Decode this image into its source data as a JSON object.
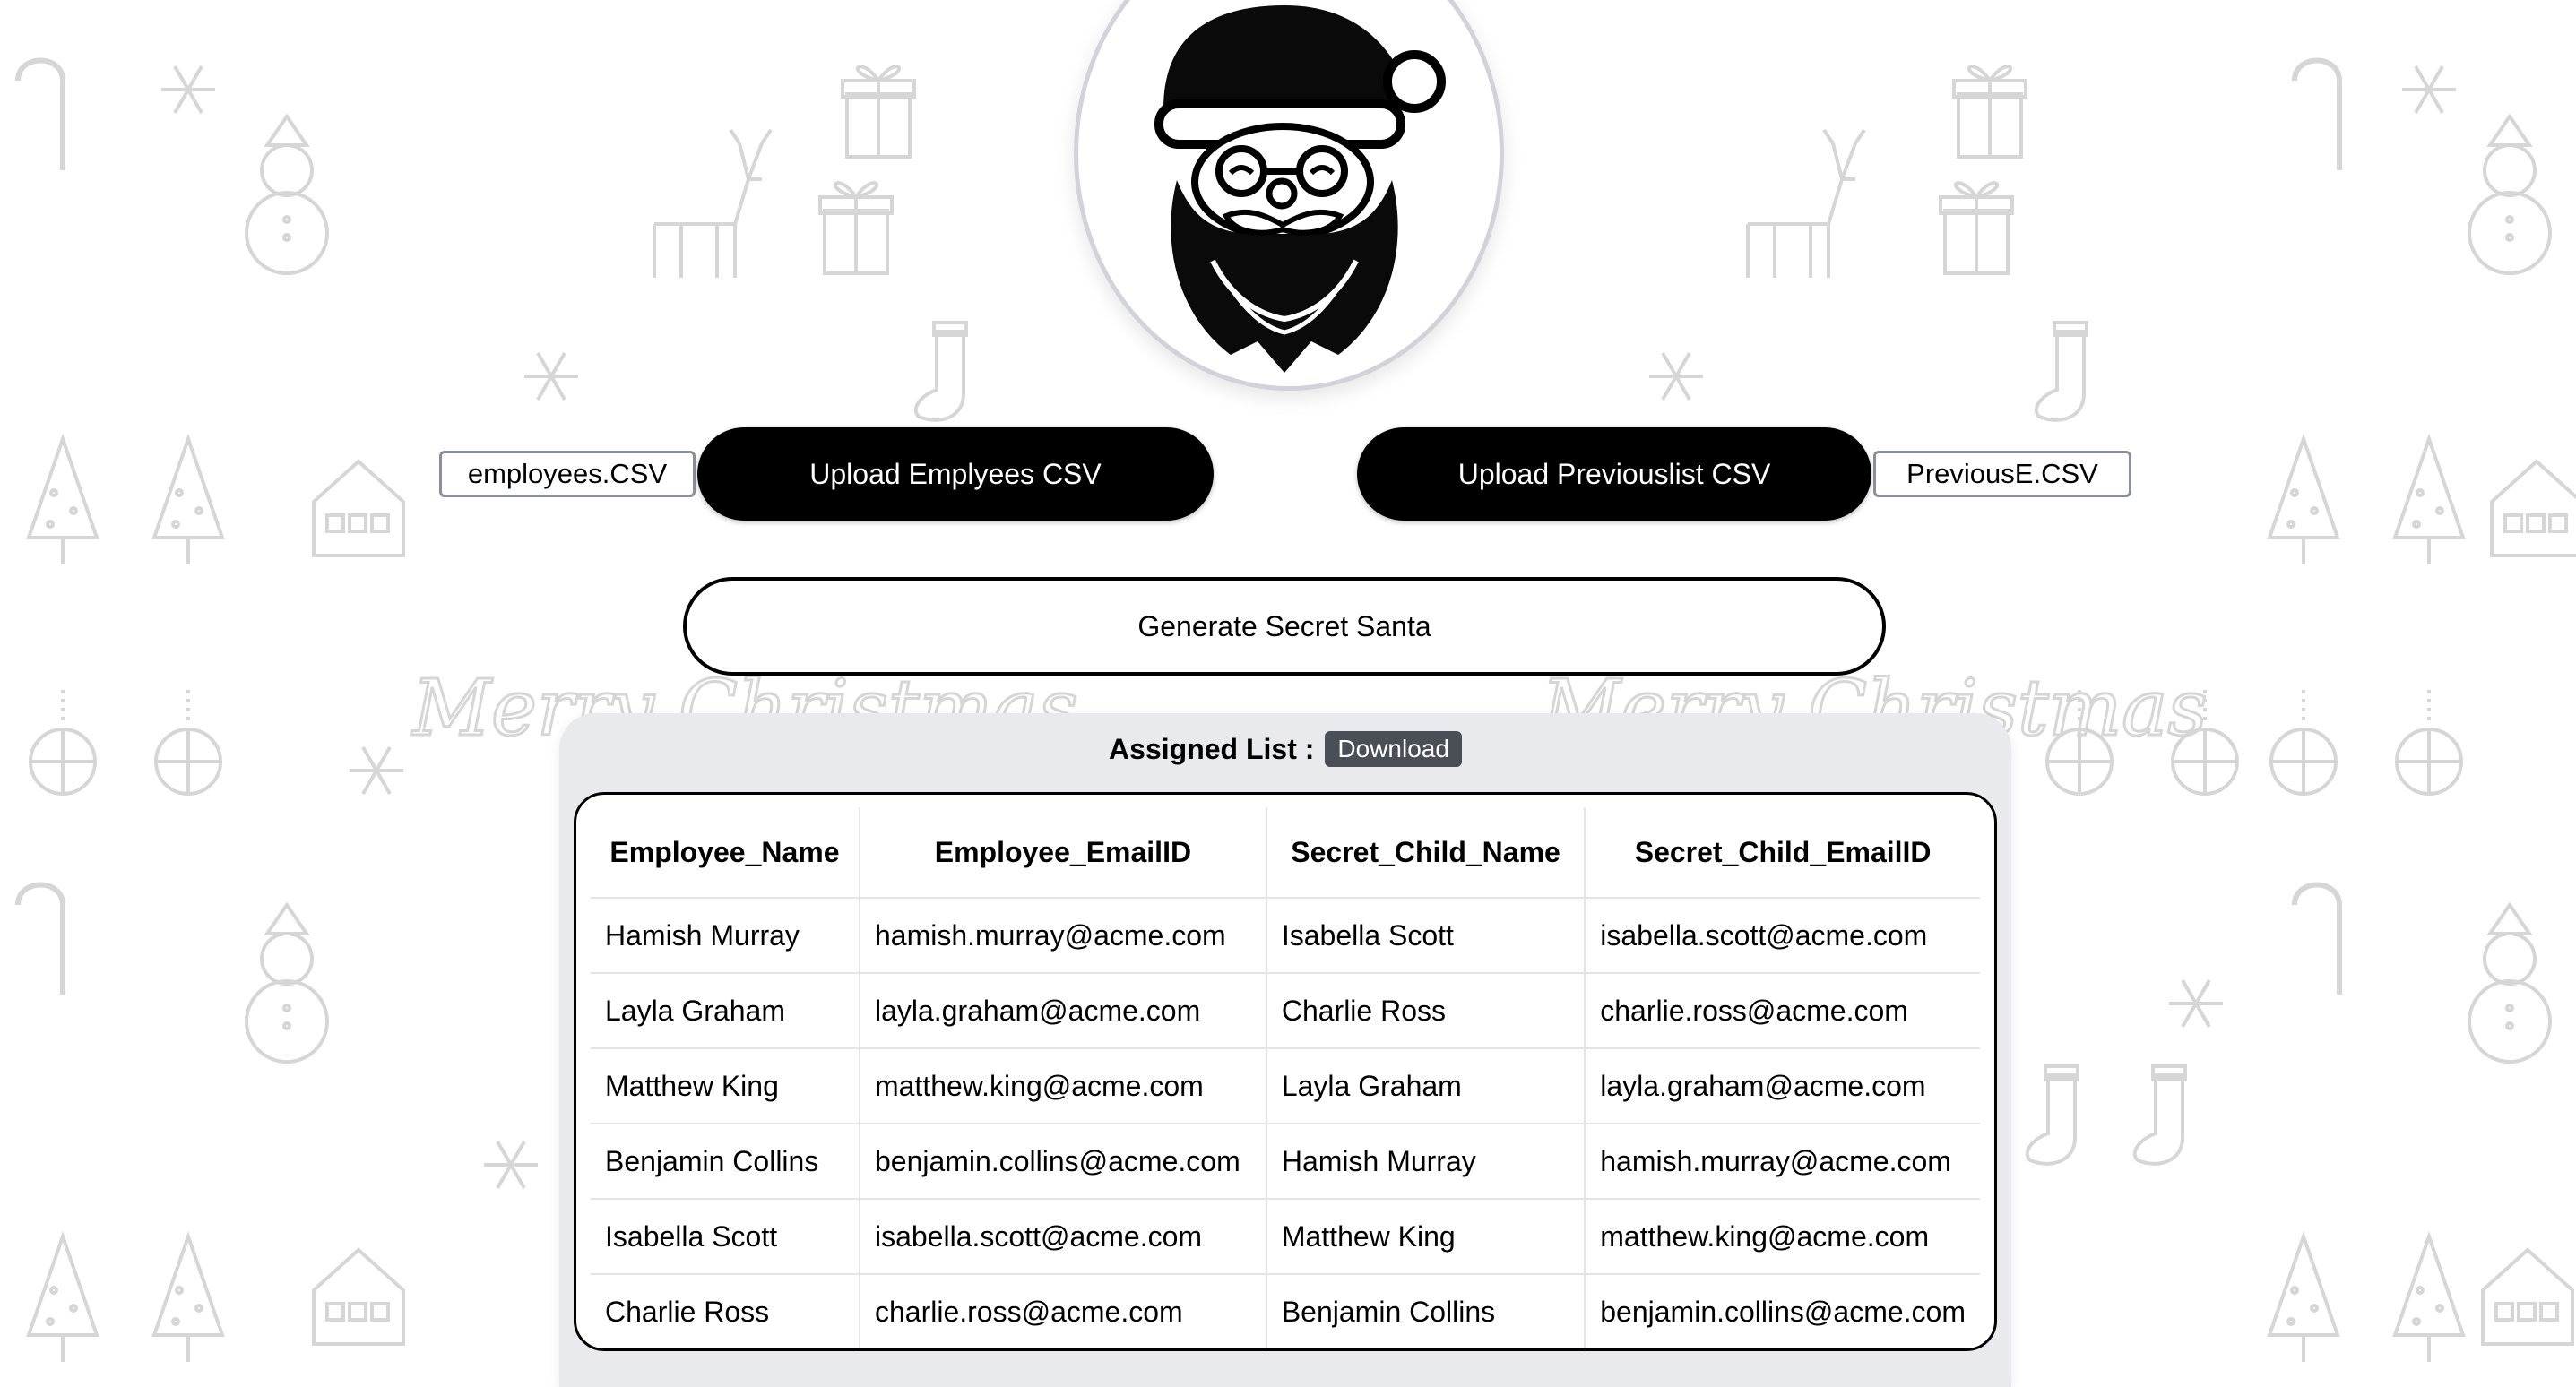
{
  "upload": {
    "employees_file": "employees.CSV",
    "employees_button": "Upload Emplyees CSV",
    "previous_button": "Upload Previouslist CSV",
    "previous_file": "PreviousE.CSV"
  },
  "generate_button": "Generate Secret Santa",
  "assigned": {
    "title": "Assigned List :",
    "download_label": "Download",
    "columns": [
      "Employee_Name",
      "Employee_EmailID",
      "Secret_Child_Name",
      "Secret_Child_EmailID"
    ],
    "rows": [
      [
        "Hamish Murray",
        "hamish.murray@acme.com",
        "Isabella Scott",
        "isabella.scott@acme.com"
      ],
      [
        "Layla Graham",
        "layla.graham@acme.com",
        "Charlie Ross",
        "charlie.ross@acme.com"
      ],
      [
        "Matthew King",
        "matthew.king@acme.com",
        "Layla Graham",
        "layla.graham@acme.com"
      ],
      [
        "Benjamin Collins",
        "benjamin.collins@acme.com",
        "Hamish Murray",
        "hamish.murray@acme.com"
      ],
      [
        "Isabella Scott",
        "isabella.scott@acme.com",
        "Matthew King",
        "matthew.king@acme.com"
      ],
      [
        "Charlie Ross",
        "charlie.ross@acme.com",
        "Benjamin Collins",
        "benjamin.collins@acme.com"
      ]
    ]
  },
  "background": {
    "pattern_text": "Merry Christmas",
    "motif_color": "#d6d6d6"
  },
  "icons": {
    "logo": "santa-face-icon"
  },
  "colors": {
    "primary_button": "#000000",
    "download_button": "#4a4e56",
    "panel_bg": "#e9eaee"
  }
}
